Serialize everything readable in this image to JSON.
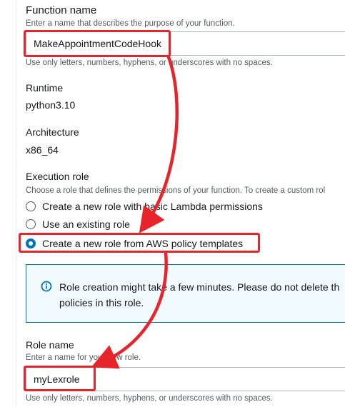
{
  "function_name": {
    "label": "Function name",
    "hint": "Enter a name that describes the purpose of your function.",
    "value": "MakeAppointmentCodeHook",
    "constraint": "Use only letters, numbers, hyphens, or underscores with no spaces."
  },
  "runtime": {
    "label": "Runtime",
    "value": "python3.10"
  },
  "architecture": {
    "label": "Architecture",
    "value": "x86_64"
  },
  "execution_role": {
    "label": "Execution role",
    "hint": "Choose a role that defines the permissions of your function. To create a custom rol",
    "options": [
      {
        "label": "Create a new role with basic Lambda permissions",
        "selected": false
      },
      {
        "label": "Use an existing role",
        "selected": false
      },
      {
        "label": "Create a new role from AWS policy templates",
        "selected": true
      }
    ]
  },
  "info_alert": {
    "line1": "Role creation might take a few minutes. Please do not delete th",
    "line2": "policies in this role."
  },
  "role_name": {
    "label": "Role name",
    "hint": "Enter a name for your new role.",
    "value": "myLexrole",
    "constraint": "Use only letters, numbers, hyphens, or underscores with no spaces."
  },
  "colors": {
    "annotation_red": "#e8242b",
    "accent_blue": "#0073bb",
    "info_background": "#f1faff"
  },
  "icons": {
    "info": "info-circle-icon",
    "arrows": "annotation-arrow-icon"
  }
}
